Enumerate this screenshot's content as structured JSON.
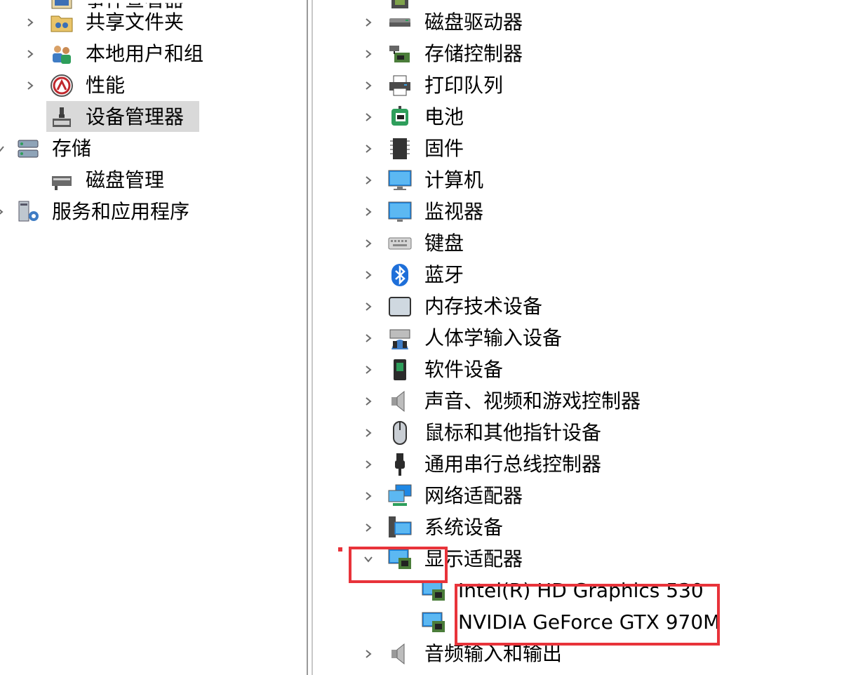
{
  "left_tree": {
    "items": [
      {
        "label": "共享文件夹",
        "icon": "shared-folder-icon",
        "expandable": true
      },
      {
        "label": "本地用户和组",
        "icon": "users-groups-icon",
        "expandable": true
      },
      {
        "label": "性能",
        "icon": "performance-icon",
        "expandable": true
      },
      {
        "label": "设备管理器",
        "icon": "device-manager-icon",
        "expandable": false,
        "selected": true
      },
      {
        "label": "存储",
        "icon": "storage-icon",
        "expanded": true
      },
      {
        "label": "磁盘管理",
        "icon": "disk-management-icon",
        "expandable": false
      },
      {
        "label": "服务和应用程序",
        "icon": "services-apps-icon",
        "expandable": true
      }
    ]
  },
  "device_tree": {
    "categories": [
      {
        "label": "磁盘驱动器",
        "icon": "disk-drive-icon"
      },
      {
        "label": "存储控制器",
        "icon": "storage-controller-icon"
      },
      {
        "label": "打印队列",
        "icon": "printer-icon"
      },
      {
        "label": "电池",
        "icon": "battery-icon"
      },
      {
        "label": "固件",
        "icon": "firmware-chip-icon"
      },
      {
        "label": "计算机",
        "icon": "computer-icon"
      },
      {
        "label": "监视器",
        "icon": "monitor-icon"
      },
      {
        "label": "键盘",
        "icon": "keyboard-icon"
      },
      {
        "label": "蓝牙",
        "icon": "bluetooth-icon"
      },
      {
        "label": "内存技术设备",
        "icon": "memory-device-icon"
      },
      {
        "label": "人体学输入设备",
        "icon": "hid-icon"
      },
      {
        "label": "软件设备",
        "icon": "software-device-icon"
      },
      {
        "label": "声音、视频和游戏控制器",
        "icon": "speaker-icon"
      },
      {
        "label": "鼠标和其他指针设备",
        "icon": "mouse-icon"
      },
      {
        "label": "通用串行总线控制器",
        "icon": "usb-icon"
      },
      {
        "label": "网络适配器",
        "icon": "network-adapter-icon"
      },
      {
        "label": "系统设备",
        "icon": "system-device-icon"
      },
      {
        "label": "显示适配器",
        "icon": "display-adapter-icon",
        "expanded": true
      },
      {
        "label": "音频输入和输出",
        "icon": "speaker-icon"
      }
    ],
    "display_adapters": [
      {
        "label": "Intel(R) HD Graphics 530",
        "icon": "display-adapter-icon"
      },
      {
        "label": "NVIDIA GeForce GTX 970M",
        "icon": "display-adapter-icon"
      }
    ]
  },
  "colors": {
    "annotation_red": "#e8333a",
    "selection_gray": "#d9d9d9",
    "chevron": "#6b6b6b"
  }
}
